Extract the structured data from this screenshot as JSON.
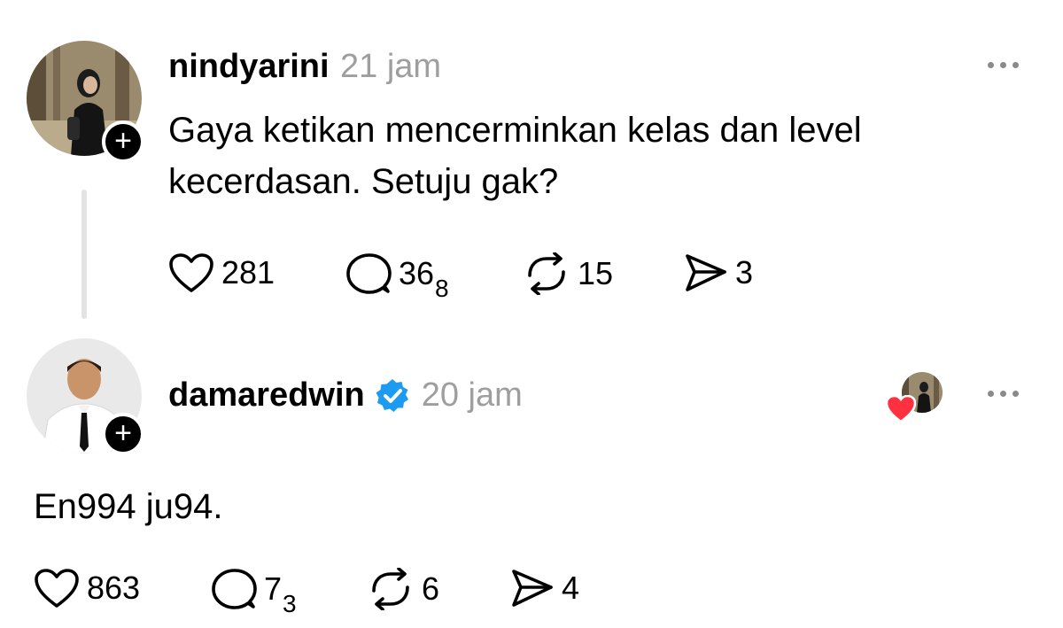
{
  "posts": [
    {
      "username": "nindyarini",
      "time": "21 jam",
      "text_line1": "Gaya ketikan mencerminkan kelas dan level",
      "text_line2": "kecerdasan. Setuju gak?",
      "likes": "281",
      "replies": "36",
      "replies_sub": "8",
      "reposts": "15",
      "shares": "3",
      "follow_icon": "plus-icon",
      "more_icon": "more-icon"
    },
    {
      "username": "damaredwin",
      "verified_icon": "verified-badge-icon",
      "time": "20 jam",
      "text": "En994 ju94.",
      "likes": "863",
      "replies": "7",
      "replies_sub": "3",
      "reposts": "6",
      "shares": "4",
      "liked_by_icon": "heart-icon",
      "follow_icon": "plus-icon",
      "more_icon": "more-icon"
    }
  ],
  "colors": {
    "verified": "#1d9bf0",
    "liked_heart": "#ff3040",
    "muted_text": "#9e9e9e",
    "thread_line": "#e3e3e3"
  }
}
